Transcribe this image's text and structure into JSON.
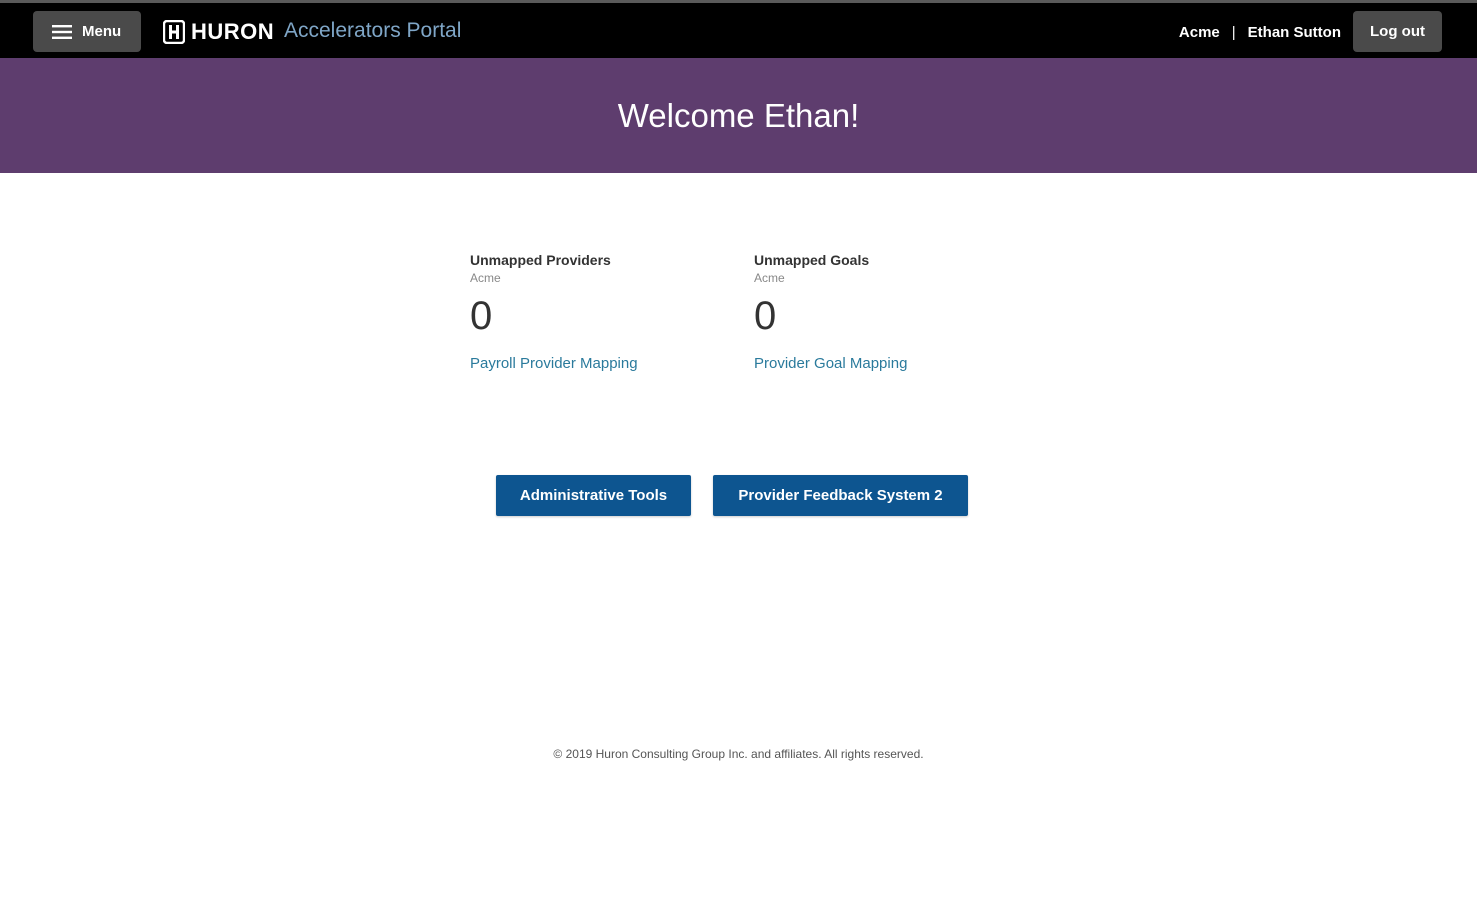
{
  "header": {
    "menu_label": "Menu",
    "logo_text": "HURON",
    "portal_name": "Accelerators Portal",
    "organization": "Acme",
    "separator": "|",
    "user_name": "Ethan Sutton",
    "logout_label": "Log out"
  },
  "banner": {
    "welcome": "Welcome Ethan!"
  },
  "stats": [
    {
      "title": "Unmapped Providers",
      "org": "Acme",
      "value": "0",
      "link": "Payroll Provider Mapping"
    },
    {
      "title": "Unmapped Goals",
      "org": "Acme",
      "value": "0",
      "link": "Provider Goal Mapping"
    }
  ],
  "actions": {
    "admin_tools": "Administrative Tools",
    "feedback_system": "Provider Feedback System 2"
  },
  "footer": {
    "copyright": "© 2019 Huron Consulting Group Inc. and affiliates. All rights reserved."
  },
  "colors": {
    "topbar": "#000000",
    "banner": "#5e3d6e",
    "primary_button": "#0d5590",
    "link": "#2a7a9c",
    "portal_name": "#7fa6c7"
  },
  "icons": {
    "menu": "hamburger-icon",
    "logo": "huron-logo-icon"
  }
}
